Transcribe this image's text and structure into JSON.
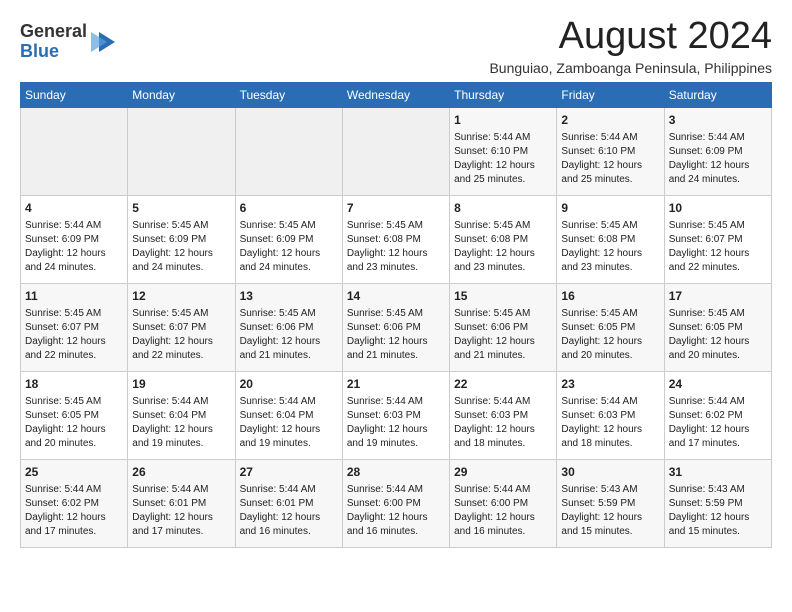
{
  "header": {
    "logo_general": "General",
    "logo_blue": "Blue",
    "month_year": "August 2024",
    "location": "Bunguiao, Zamboanga Peninsula, Philippines"
  },
  "weekdays": [
    "Sunday",
    "Monday",
    "Tuesday",
    "Wednesday",
    "Thursday",
    "Friday",
    "Saturday"
  ],
  "weeks": [
    [
      {
        "day": "",
        "content": ""
      },
      {
        "day": "",
        "content": ""
      },
      {
        "day": "",
        "content": ""
      },
      {
        "day": "",
        "content": ""
      },
      {
        "day": "1",
        "content": "Sunrise: 5:44 AM\nSunset: 6:10 PM\nDaylight: 12 hours\nand 25 minutes."
      },
      {
        "day": "2",
        "content": "Sunrise: 5:44 AM\nSunset: 6:10 PM\nDaylight: 12 hours\nand 25 minutes."
      },
      {
        "day": "3",
        "content": "Sunrise: 5:44 AM\nSunset: 6:09 PM\nDaylight: 12 hours\nand 24 minutes."
      }
    ],
    [
      {
        "day": "4",
        "content": "Sunrise: 5:44 AM\nSunset: 6:09 PM\nDaylight: 12 hours\nand 24 minutes."
      },
      {
        "day": "5",
        "content": "Sunrise: 5:45 AM\nSunset: 6:09 PM\nDaylight: 12 hours\nand 24 minutes."
      },
      {
        "day": "6",
        "content": "Sunrise: 5:45 AM\nSunset: 6:09 PM\nDaylight: 12 hours\nand 24 minutes."
      },
      {
        "day": "7",
        "content": "Sunrise: 5:45 AM\nSunset: 6:08 PM\nDaylight: 12 hours\nand 23 minutes."
      },
      {
        "day": "8",
        "content": "Sunrise: 5:45 AM\nSunset: 6:08 PM\nDaylight: 12 hours\nand 23 minutes."
      },
      {
        "day": "9",
        "content": "Sunrise: 5:45 AM\nSunset: 6:08 PM\nDaylight: 12 hours\nand 23 minutes."
      },
      {
        "day": "10",
        "content": "Sunrise: 5:45 AM\nSunset: 6:07 PM\nDaylight: 12 hours\nand 22 minutes."
      }
    ],
    [
      {
        "day": "11",
        "content": "Sunrise: 5:45 AM\nSunset: 6:07 PM\nDaylight: 12 hours\nand 22 minutes."
      },
      {
        "day": "12",
        "content": "Sunrise: 5:45 AM\nSunset: 6:07 PM\nDaylight: 12 hours\nand 22 minutes."
      },
      {
        "day": "13",
        "content": "Sunrise: 5:45 AM\nSunset: 6:06 PM\nDaylight: 12 hours\nand 21 minutes."
      },
      {
        "day": "14",
        "content": "Sunrise: 5:45 AM\nSunset: 6:06 PM\nDaylight: 12 hours\nand 21 minutes."
      },
      {
        "day": "15",
        "content": "Sunrise: 5:45 AM\nSunset: 6:06 PM\nDaylight: 12 hours\nand 21 minutes."
      },
      {
        "day": "16",
        "content": "Sunrise: 5:45 AM\nSunset: 6:05 PM\nDaylight: 12 hours\nand 20 minutes."
      },
      {
        "day": "17",
        "content": "Sunrise: 5:45 AM\nSunset: 6:05 PM\nDaylight: 12 hours\nand 20 minutes."
      }
    ],
    [
      {
        "day": "18",
        "content": "Sunrise: 5:45 AM\nSunset: 6:05 PM\nDaylight: 12 hours\nand 20 minutes."
      },
      {
        "day": "19",
        "content": "Sunrise: 5:44 AM\nSunset: 6:04 PM\nDaylight: 12 hours\nand 19 minutes."
      },
      {
        "day": "20",
        "content": "Sunrise: 5:44 AM\nSunset: 6:04 PM\nDaylight: 12 hours\nand 19 minutes."
      },
      {
        "day": "21",
        "content": "Sunrise: 5:44 AM\nSunset: 6:03 PM\nDaylight: 12 hours\nand 19 minutes."
      },
      {
        "day": "22",
        "content": "Sunrise: 5:44 AM\nSunset: 6:03 PM\nDaylight: 12 hours\nand 18 minutes."
      },
      {
        "day": "23",
        "content": "Sunrise: 5:44 AM\nSunset: 6:03 PM\nDaylight: 12 hours\nand 18 minutes."
      },
      {
        "day": "24",
        "content": "Sunrise: 5:44 AM\nSunset: 6:02 PM\nDaylight: 12 hours\nand 17 minutes."
      }
    ],
    [
      {
        "day": "25",
        "content": "Sunrise: 5:44 AM\nSunset: 6:02 PM\nDaylight: 12 hours\nand 17 minutes."
      },
      {
        "day": "26",
        "content": "Sunrise: 5:44 AM\nSunset: 6:01 PM\nDaylight: 12 hours\nand 17 minutes."
      },
      {
        "day": "27",
        "content": "Sunrise: 5:44 AM\nSunset: 6:01 PM\nDaylight: 12 hours\nand 16 minutes."
      },
      {
        "day": "28",
        "content": "Sunrise: 5:44 AM\nSunset: 6:00 PM\nDaylight: 12 hours\nand 16 minutes."
      },
      {
        "day": "29",
        "content": "Sunrise: 5:44 AM\nSunset: 6:00 PM\nDaylight: 12 hours\nand 16 minutes."
      },
      {
        "day": "30",
        "content": "Sunrise: 5:43 AM\nSunset: 5:59 PM\nDaylight: 12 hours\nand 15 minutes."
      },
      {
        "day": "31",
        "content": "Sunrise: 5:43 AM\nSunset: 5:59 PM\nDaylight: 12 hours\nand 15 minutes."
      }
    ]
  ]
}
